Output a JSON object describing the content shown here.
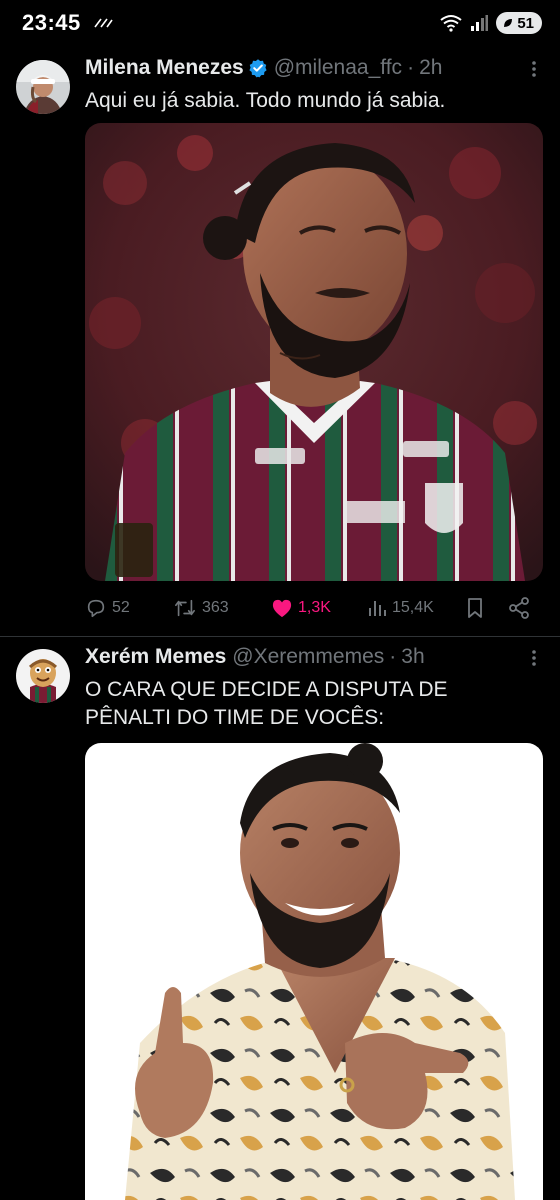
{
  "status_bar": {
    "time": "23:45",
    "battery": "51",
    "icons": [
      "signal-dots-icon",
      "wifi-icon",
      "cell-signal-icon",
      "battery-icon"
    ]
  },
  "tweets": [
    {
      "author_name": "Milena Menezes",
      "verified": true,
      "handle": "@milenaa_ffc",
      "separator": "·",
      "age": "2h",
      "text": "Aqui eu já sabia. Todo mundo já sabia.",
      "media_alt": "Bearded soccer player in a maroon, green and white striped jersey",
      "replies": "52",
      "retweets": "363",
      "likes": "1,3K",
      "views": "15,4K",
      "liked": true
    },
    {
      "author_name": "Xerém Memes",
      "verified": false,
      "handle": "@Xeremmemes",
      "separator": "·",
      "age": "3h",
      "text_line1": "O CARA QUE DECIDE A DISPUTA DE",
      "text_line2": "PÊNALTI DO TIME DE VOCÊS:",
      "media_alt": "Smiling man in patterned shirt pointing at the camera"
    }
  ],
  "colors": {
    "background": "#000000",
    "text_primary": "#e7e9ea",
    "text_secondary": "#71767b",
    "like_pink": "#f91880",
    "verified_blue": "#1d9bf0",
    "divider": "#2f3336"
  }
}
